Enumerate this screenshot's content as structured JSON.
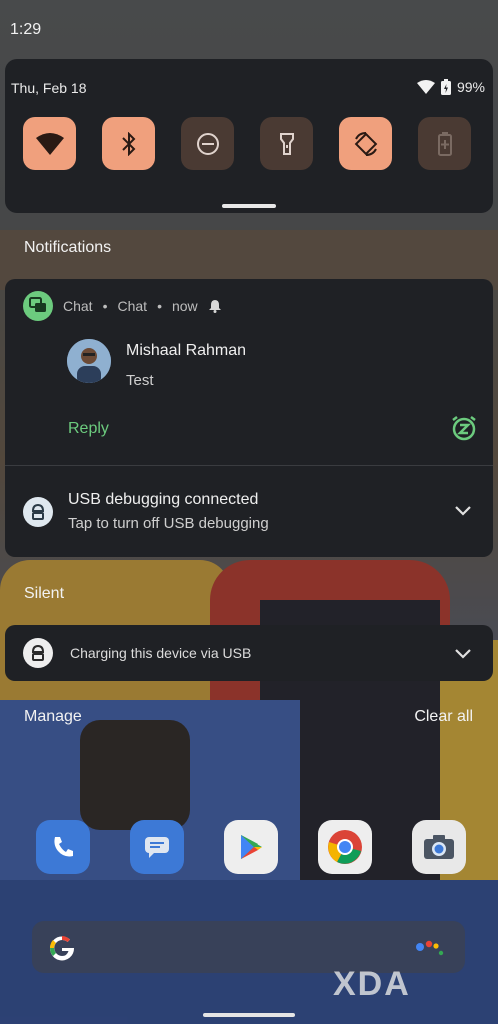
{
  "status": {
    "time": "1:29"
  },
  "quick_settings": {
    "date": "Thu, Feb 18",
    "battery": "99%",
    "tiles": [
      {
        "name": "wifi-icon",
        "state": "on"
      },
      {
        "name": "bluetooth-icon",
        "state": "on"
      },
      {
        "name": "do-not-disturb-icon",
        "state": "off"
      },
      {
        "name": "flashlight-icon",
        "state": "off"
      },
      {
        "name": "auto-rotate-icon",
        "state": "on"
      },
      {
        "name": "battery-saver-icon",
        "state": "off"
      }
    ]
  },
  "notifications": {
    "header": "Notifications",
    "chat": {
      "app": "Chat",
      "channel": "Chat",
      "time": "now",
      "sender": "Mishaal Rahman",
      "message": "Test",
      "reply_label": "Reply"
    },
    "usb": {
      "title": "USB debugging connected",
      "subtitle": "Tap to turn off USB debugging"
    }
  },
  "silent": {
    "header": "Silent",
    "charging_text": "Charging this device via USB"
  },
  "footer": {
    "manage": "Manage",
    "clear_all": "Clear all"
  },
  "watermark": "XDA",
  "colors": {
    "accent_tile": "#f0a07d",
    "reply_green": "#6ccb7e",
    "card_bg": "#1f2125"
  }
}
